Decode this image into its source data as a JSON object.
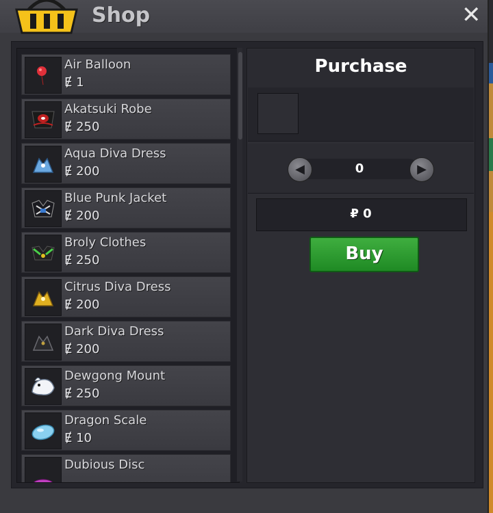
{
  "window": {
    "title": "Shop",
    "close_glyph": "✕"
  },
  "items": [
    {
      "name": "Air Balloon",
      "price": "Ɇ 1",
      "icon": "balloon-icon"
    },
    {
      "name": "Akatsuki Robe",
      "price": "Ɇ 250",
      "icon": "akatsuki-robe-icon"
    },
    {
      "name": "Aqua Diva Dress",
      "price": "Ɇ 200",
      "icon": "aqua-diva-dress-icon"
    },
    {
      "name": "Blue Punk Jacket",
      "price": "Ɇ 200",
      "icon": "blue-punk-jacket-icon"
    },
    {
      "name": "Broly Clothes",
      "price": "Ɇ 250",
      "icon": "broly-clothes-icon"
    },
    {
      "name": "Citrus Diva Dress",
      "price": "Ɇ 200",
      "icon": "citrus-diva-dress-icon"
    },
    {
      "name": "Dark Diva Dress",
      "price": "Ɇ 200",
      "icon": "dark-diva-dress-icon"
    },
    {
      "name": "Dewgong Mount",
      "price": "Ɇ 250",
      "icon": "dewgong-mount-icon"
    },
    {
      "name": "Dragon Scale",
      "price": "Ɇ 10",
      "icon": "dragon-scale-icon"
    },
    {
      "name": "Dubious Disc",
      "price": "",
      "icon": "dubious-disc-icon"
    }
  ],
  "purchase": {
    "title": "Purchase",
    "quantity": "0",
    "total": "₽ 0",
    "buy_label": "Buy",
    "decrease_glyph": "◀",
    "increase_glyph": "▶"
  },
  "colors": {
    "buy_green": "#2a9a2e",
    "panel_dark": "#1f1f25",
    "item_bg": "#3e3e44"
  }
}
